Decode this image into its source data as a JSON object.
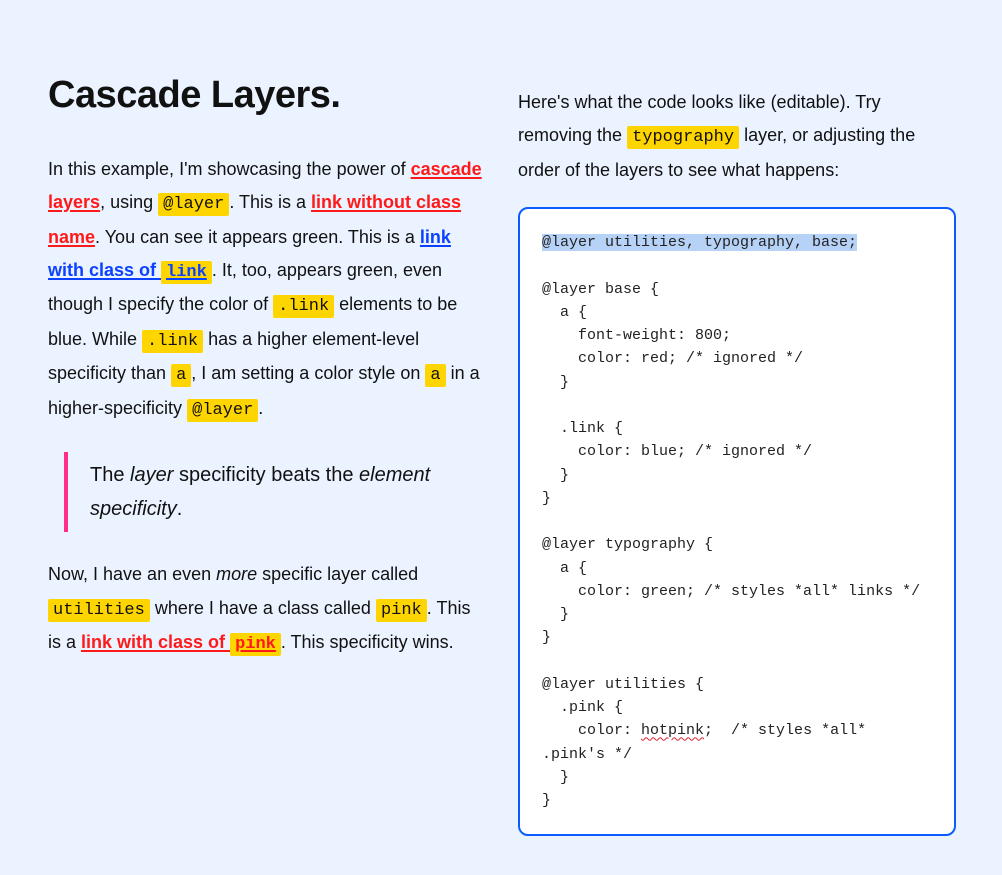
{
  "title": "Cascade Layers.",
  "left": {
    "p1_a": "In this example, I'm showcasing the power of ",
    "link_cascade": "cascade layers",
    "p1_b": ", using ",
    "code_layer": "@layer",
    "p1_c": ". This is a ",
    "link_noclass": "link without class name",
    "p1_d": ". You can see it appears green. This is a ",
    "link_withclass_a": "link with class of ",
    "code_link_in_link": "link",
    "p1_e": ". It, too, appears green, even though I specify the color of ",
    "code_dotlink1": ".link",
    "p1_f": " elements to be blue. While ",
    "code_dotlink2": ".link",
    "p1_g": " has a higher element-level specificity than ",
    "code_a1": "a",
    "p1_h": ", I am setting a color style on ",
    "code_a2": "a",
    "p1_i": " in a higher-specificity ",
    "code_layer2": "@layer",
    "p1_j": ".",
    "bq_a": "The ",
    "bq_em1": "layer",
    "bq_b": " specificity beats the ",
    "bq_em2": "element specificity",
    "bq_c": ".",
    "p2_a": "Now, I have an even ",
    "p2_em": "more",
    "p2_b": " specific layer called ",
    "code_util": "utilities",
    "p2_c": " where I have a class called ",
    "code_pink": "pink",
    "p2_d": ". This is a ",
    "link_pink_a": "link with class of ",
    "code_pink_in_link": "pink",
    "p2_e": ". This specificity wins."
  },
  "right": {
    "intro_a": "Here's what the code looks like (editable). Try removing the ",
    "code_typo": "typography",
    "intro_b": " layer, or adjusting the order of the layers to see what happens:"
  },
  "code": {
    "sel": "@layer utilities, typography, base;",
    "block1": "\n\n@layer base {\n  a {\n    font-weight: 800;\n    color: red; /* ignored */\n  }\n\n  .link {\n    color: blue; /* ignored */\n  }\n}\n\n@layer typography {\n  a {\n    color: green; /* styles *all* links */\n  }\n}\n\n@layer utilities {\n  .pink {\n    color: ",
    "hotpink": "hotpink",
    "block2": ";  /* styles *all* .pink's */\n  }\n}"
  }
}
